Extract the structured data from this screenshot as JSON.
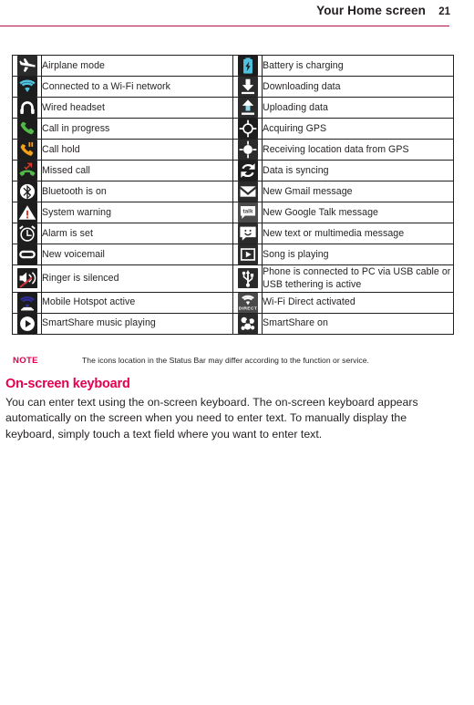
{
  "header": {
    "title": "Your Home screen",
    "page_number": "21",
    "rule_color": "#b3104b"
  },
  "icon_table": {
    "rows": [
      {
        "left": {
          "icon": "airplane-mode-icon",
          "label": "Airplane mode"
        },
        "right": {
          "icon": "battery-charging-icon",
          "label": "Battery is charging"
        }
      },
      {
        "left": {
          "icon": "wifi-connected-icon",
          "label": "Connected to a Wi-Fi network"
        },
        "right": {
          "icon": "download-data-icon",
          "label": "Downloading data"
        }
      },
      {
        "left": {
          "icon": "wired-headset-icon",
          "label": "Wired headset"
        },
        "right": {
          "icon": "upload-data-icon",
          "label": "Uploading data"
        }
      },
      {
        "left": {
          "icon": "call-in-progress-icon",
          "label": "Call in progress"
        },
        "right": {
          "icon": "acquiring-gps-icon",
          "label": "Acquiring GPS"
        }
      },
      {
        "left": {
          "icon": "call-hold-icon",
          "label": "Call hold"
        },
        "right": {
          "icon": "receiving-gps-icon",
          "label": "Receiving location data from GPS"
        }
      },
      {
        "left": {
          "icon": "missed-call-icon",
          "label": "Missed call"
        },
        "right": {
          "icon": "data-syncing-icon",
          "label": "Data is syncing"
        }
      },
      {
        "left": {
          "icon": "bluetooth-icon",
          "label": "Bluetooth is on"
        },
        "right": {
          "icon": "gmail-message-icon",
          "label": "New Gmail message"
        }
      },
      {
        "left": {
          "icon": "system-warning-icon",
          "label": "System warning"
        },
        "right": {
          "icon": "google-talk-message-icon",
          "label": "New Google Talk message"
        }
      },
      {
        "left": {
          "icon": "alarm-set-icon",
          "label": "Alarm is set"
        },
        "right": {
          "icon": "sms-mms-message-icon",
          "label": "New text or multimedia message"
        }
      },
      {
        "left": {
          "icon": "voicemail-icon",
          "label": "New voicemail"
        },
        "right": {
          "icon": "song-playing-icon",
          "label": "Song is playing"
        }
      },
      {
        "left": {
          "icon": "ringer-silenced-icon",
          "label": "Ringer is silenced"
        },
        "right": {
          "icon": "usb-connected-icon",
          "label": "Phone is connected to PC via USB cable or USB tethering is active"
        }
      },
      {
        "left": {
          "icon": "mobile-hotspot-icon",
          "label": "Mobile Hotspot active"
        },
        "right": {
          "icon": "wifi-direct-icon",
          "label": "Wi-Fi Direct activated"
        }
      },
      {
        "left": {
          "icon": "smartshare-music-icon",
          "label": "SmartShare music playing"
        },
        "right": {
          "icon": "smartshare-on-icon",
          "label": "SmartShare on"
        }
      }
    ]
  },
  "note": {
    "label": "NOTE",
    "text": "The icons location in the Status Bar may differ according to the function or service.",
    "label_color": "#e3004f"
  },
  "section": {
    "heading": "On-screen keyboard",
    "heading_color": "#e3004f",
    "body": "You can enter text using the on-screen keyboard. The on-screen keyboard appears automatically on the screen when you need to enter text. To manually display the keyboard, simply touch a text field where you want to enter text."
  }
}
